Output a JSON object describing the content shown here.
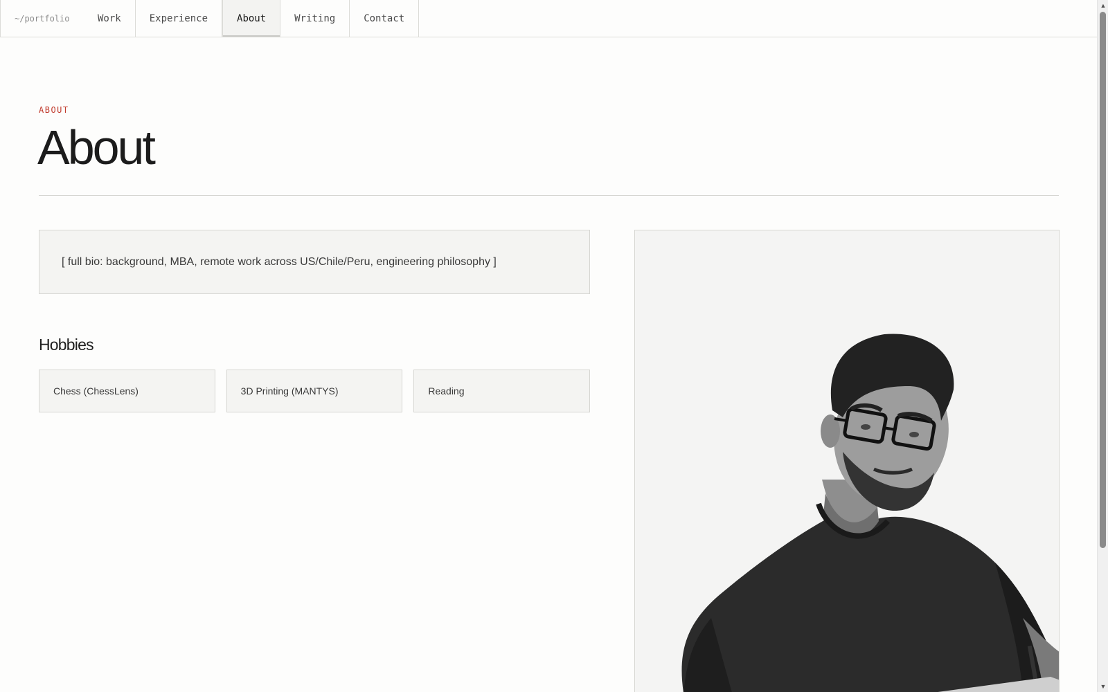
{
  "nav": {
    "brand": "~/portfolio",
    "tabs": [
      {
        "label": "Work",
        "active": false
      },
      {
        "label": "Experience",
        "active": false
      },
      {
        "label": "About",
        "active": true
      },
      {
        "label": "Writing",
        "active": false
      },
      {
        "label": "Contact",
        "active": false
      }
    ]
  },
  "page": {
    "eyebrow": "ABOUT",
    "title": "About"
  },
  "bio": {
    "text": "[ full bio: background, MBA, remote work across US/Chile/Peru, engineering philosophy ]"
  },
  "hobbies": {
    "title": "Hobbies",
    "items": [
      "Chess (ChessLens)",
      "3D Printing (MANTYS)",
      "Reading"
    ]
  },
  "colors": {
    "accent": "#c0392b",
    "background": "#fdfdfc",
    "card": "#f4f4f2",
    "border": "#d6d6d2"
  },
  "scrollbar": {
    "up_icon": "▲",
    "down_icon": "▼"
  }
}
